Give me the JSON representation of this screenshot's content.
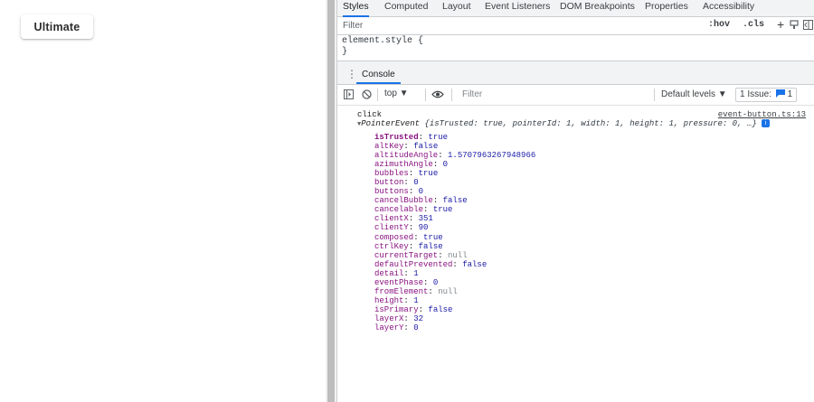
{
  "page": {
    "button_label": "Ultimate"
  },
  "devtools": {
    "tabs": [
      "Styles",
      "Computed",
      "Layout",
      "Event Listeners",
      "DOM Breakpoints",
      "Properties",
      "Accessibility"
    ],
    "styles_filter_placeholder": "Filter",
    "hov_label": ":hov",
    "cls_label": ".cls",
    "plus_label": "+",
    "element_style_line1": "element.style {",
    "element_style_line2": "}",
    "drawer_tab": "Console",
    "toolbar": {
      "context": "top ▼",
      "filter_placeholder": "Filter",
      "levels": "Default levels ▼",
      "issues": "1 Issue:",
      "issues_count": "1"
    },
    "console": {
      "message": "click",
      "source": "event-button.ts:13",
      "object_type": "PointerEvent",
      "object_preview": "{isTrusted: true, pointerId: 1, width: 1, height: 1, pressure: 0, …}",
      "info_icon": "i",
      "properties": [
        {
          "key": "isTrusted",
          "value": "true",
          "bold": true
        },
        {
          "key": "altKey",
          "value": "false"
        },
        {
          "key": "altitudeAngle",
          "value": "1.5707963267948966"
        },
        {
          "key": "azimuthAngle",
          "value": "0"
        },
        {
          "key": "bubbles",
          "value": "true"
        },
        {
          "key": "button",
          "value": "0"
        },
        {
          "key": "buttons",
          "value": "0"
        },
        {
          "key": "cancelBubble",
          "value": "false"
        },
        {
          "key": "cancelable",
          "value": "true"
        },
        {
          "key": "clientX",
          "value": "351"
        },
        {
          "key": "clientY",
          "value": "90"
        },
        {
          "key": "composed",
          "value": "true"
        },
        {
          "key": "ctrlKey",
          "value": "false"
        },
        {
          "key": "currentTarget",
          "value": "null",
          "null": true
        },
        {
          "key": "defaultPrevented",
          "value": "false"
        },
        {
          "key": "detail",
          "value": "1"
        },
        {
          "key": "eventPhase",
          "value": "0"
        },
        {
          "key": "fromElement",
          "value": "null",
          "null": true
        },
        {
          "key": "height",
          "value": "1"
        },
        {
          "key": "isPrimary",
          "value": "false"
        },
        {
          "key": "layerX",
          "value": "32"
        },
        {
          "key": "layerY",
          "value": "0"
        }
      ]
    }
  }
}
